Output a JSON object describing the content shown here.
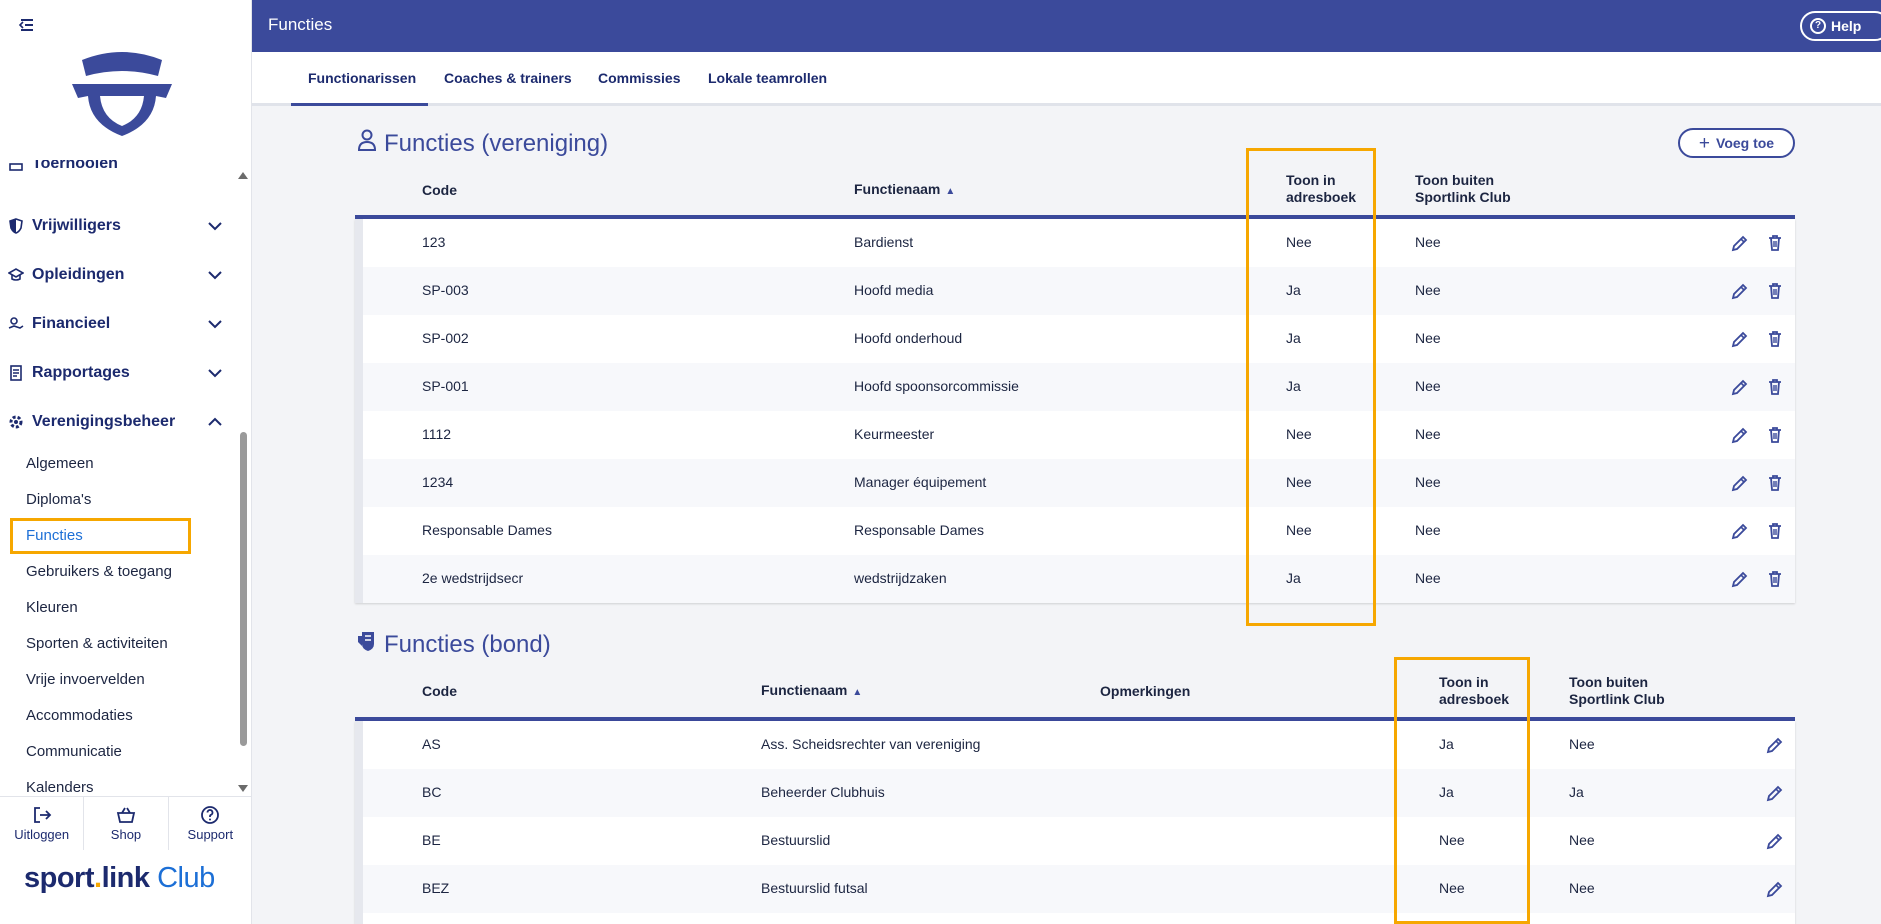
{
  "header": {
    "title": "Functies",
    "help_label": "Help"
  },
  "tabs": [
    {
      "label": "Functionarissen",
      "active": true
    },
    {
      "label": "Coaches & trainers",
      "active": false
    },
    {
      "label": "Commissies",
      "active": false
    },
    {
      "label": "Lokale teamrollen",
      "active": false
    }
  ],
  "sidebar": {
    "partial_item": "Toernooien",
    "groups": [
      {
        "label": "Vrijwilligers",
        "expanded": false
      },
      {
        "label": "Opleidingen",
        "expanded": false
      },
      {
        "label": "Financieel",
        "expanded": false
      },
      {
        "label": "Rapportages",
        "expanded": false
      },
      {
        "label": "Verenigingsbeheer",
        "expanded": true
      }
    ],
    "subitems": [
      "Algemeen",
      "Diploma's",
      "Functies",
      "Gebruikers & toegang",
      "Kleuren",
      "Sporten & activiteiten",
      "Vrije invoervelden",
      "Accommodaties",
      "Communicatie",
      "Kalenders"
    ],
    "active_subitem": "Functies",
    "bottom": {
      "logout": "Uitloggen",
      "shop": "Shop",
      "support": "Support"
    },
    "brand": {
      "part1": "sport",
      "dot": ".",
      "part2": "link",
      "part3": " Club"
    }
  },
  "vereniging": {
    "title": "Functies (vereniging)",
    "add_label": "Voeg toe",
    "columns": {
      "code": "Code",
      "naam": "Functienaam",
      "adres_line1": "Toon in",
      "adres_line2": "adresboek",
      "buiten_line1": "Toon buiten",
      "buiten_line2": "Sportlink Club"
    },
    "rows": [
      {
        "code": "123",
        "naam": "Bardienst",
        "adresboek": "Nee",
        "buiten": "Nee"
      },
      {
        "code": "SP-003",
        "naam": "Hoofd media",
        "adresboek": "Ja",
        "buiten": "Nee"
      },
      {
        "code": "SP-002",
        "naam": "Hoofd onderhoud",
        "adresboek": "Ja",
        "buiten": "Nee"
      },
      {
        "code": "SP-001",
        "naam": "Hoofd spoonsorcommissie",
        "adresboek": "Ja",
        "buiten": "Nee"
      },
      {
        "code": "1112",
        "naam": "Keurmeester",
        "adresboek": "Nee",
        "buiten": "Nee"
      },
      {
        "code": "1234",
        "naam": "Manager équipement",
        "adresboek": "Nee",
        "buiten": "Nee"
      },
      {
        "code": "Responsable Dames",
        "naam": "Responsable Dames",
        "adresboek": "Nee",
        "buiten": "Nee"
      },
      {
        "code": "2e wedstrijdsecr",
        "naam": "wedstrijdzaken",
        "adresboek": "Ja",
        "buiten": "Nee"
      }
    ]
  },
  "bond": {
    "title": "Functies (bond)",
    "columns": {
      "code": "Code",
      "naam": "Functienaam",
      "opmerkingen": "Opmerkingen",
      "adres_line1": "Toon in",
      "adres_line2": "adresboek",
      "buiten_line1": "Toon buiten",
      "buiten_line2": "Sportlink Club"
    },
    "rows": [
      {
        "code": "AS",
        "naam": "Ass. Scheidsrechter van vereniging",
        "adresboek": "Ja",
        "buiten": "Nee"
      },
      {
        "code": "BC",
        "naam": "Beheerder Clubhuis",
        "adresboek": "Ja",
        "buiten": "Ja"
      },
      {
        "code": "BE",
        "naam": "Bestuurslid",
        "adresboek": "Nee",
        "buiten": "Nee"
      },
      {
        "code": "BEZ",
        "naam": "Bestuurslid futsal",
        "adresboek": "Nee",
        "buiten": "Nee"
      }
    ]
  },
  "colors": {
    "primary": "#3b4a9b",
    "highlight": "#f6a700",
    "link": "#1c6fd6"
  }
}
